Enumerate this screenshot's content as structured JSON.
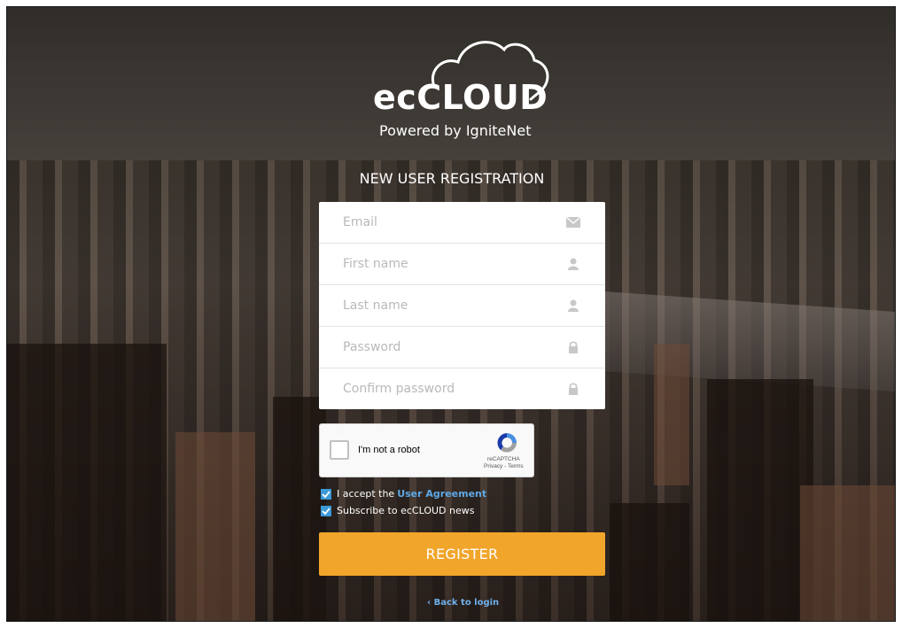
{
  "logo": {
    "brand": "ecCLOUD",
    "tagline": "Powered by IgniteNet"
  },
  "heading": "NEW USER REGISTRATION",
  "form": {
    "fields": [
      {
        "placeholder": "Email",
        "icon": "envelope-icon"
      },
      {
        "placeholder": "First name",
        "icon": "user-icon"
      },
      {
        "placeholder": "Last name",
        "icon": "user-icon"
      },
      {
        "placeholder": "Password",
        "icon": "lock-icon"
      },
      {
        "placeholder": "Confirm password",
        "icon": "lock-icon"
      }
    ]
  },
  "captcha": {
    "label": "I'm not a robot",
    "brand": "reCAPTCHA",
    "links": "Privacy - Terms"
  },
  "checkboxes": {
    "agreement_prefix": "I accept the",
    "agreement_link": "User Agreement",
    "news": "Subscribe to ecCLOUD news",
    "agreement_checked": true,
    "news_checked": true
  },
  "register_label": "REGISTER",
  "back_label": "Back to login",
  "colors": {
    "accent": "#f1a52a",
    "link": "#5ea8e6",
    "checkbox": "#3c9ad8"
  }
}
